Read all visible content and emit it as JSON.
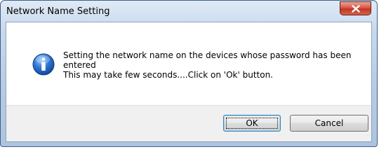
{
  "window": {
    "title": "Network Name Setting",
    "close_icon": "close-icon"
  },
  "dialog": {
    "icon": "info-icon",
    "message_line1": "Setting the network name on the devices whose password has been",
    "message_line2": "entered",
    "message_line3": "This may take few seconds....Click on 'Ok' button."
  },
  "buttons": {
    "ok_label": "OK",
    "cancel_label": "Cancel"
  },
  "colors": {
    "close_button": "#c2351f",
    "info_icon": "#1c5fb5",
    "titlebar": "#c9d9ec"
  }
}
